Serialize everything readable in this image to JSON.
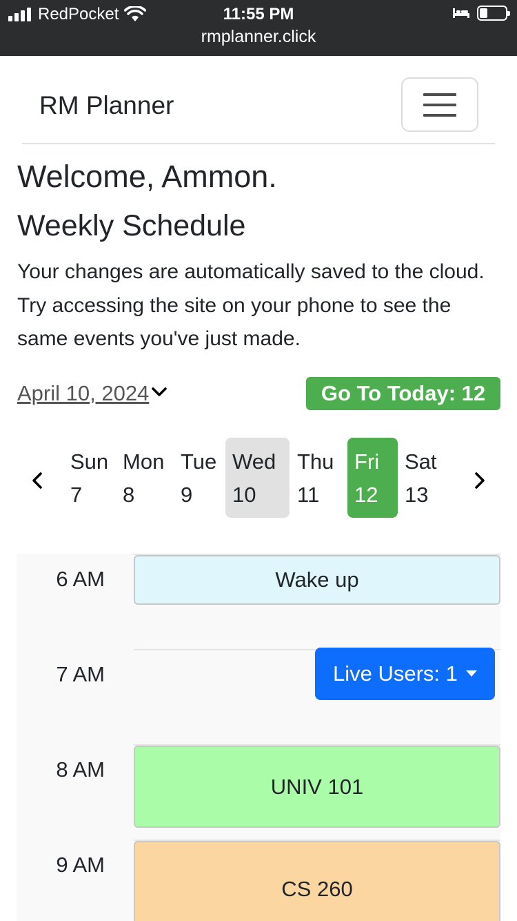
{
  "status_bar": {
    "carrier": "RedPocket",
    "time": "11:55 PM",
    "url": "rmplanner.click",
    "icons": [
      "signal-icon",
      "wifi-icon",
      "bed-icon",
      "battery-icon"
    ]
  },
  "navbar": {
    "brand": "RM Planner",
    "toggler_icon": "hamburger-menu-icon"
  },
  "page": {
    "welcome": "Welcome, Ammon.",
    "heading": "Weekly Schedule",
    "description": "Your changes are automatically saved to the cloud. Try accessing the site on your phone to see the same events you've just made."
  },
  "date_bar": {
    "selected_date": "April 10, 2024",
    "today_button": "Go To Today: 12"
  },
  "week": {
    "prev_icon": "chevron-left-icon",
    "next_icon": "chevron-right-icon",
    "days": [
      {
        "name": "Sun",
        "date": "7"
      },
      {
        "name": "Mon",
        "date": "8"
      },
      {
        "name": "Tue",
        "date": "9"
      },
      {
        "name": "Wed",
        "date": "10",
        "state": "selected"
      },
      {
        "name": "Thu",
        "date": "11"
      },
      {
        "name": "Fri",
        "date": "12",
        "state": "today"
      },
      {
        "name": "Sat",
        "date": "13"
      }
    ]
  },
  "schedule": {
    "hours": [
      "6 AM",
      "7 AM",
      "8 AM",
      "9 AM"
    ],
    "events": [
      {
        "title": "Wake up",
        "hour": "6 AM",
        "color": "#dff6fd"
      },
      {
        "title": "UNIV 101",
        "hour": "8 AM",
        "color": "#abfca9"
      },
      {
        "title": "CS 260",
        "hour": "9 AM",
        "color": "#fcd6a1"
      }
    ],
    "live_users": "Live Users: 1"
  },
  "colors": {
    "status_bar_bg": "#2b2d2f",
    "success": "#4cae4f",
    "primary": "#0d6efd",
    "selected_day_bg": "#e1e1e1"
  }
}
